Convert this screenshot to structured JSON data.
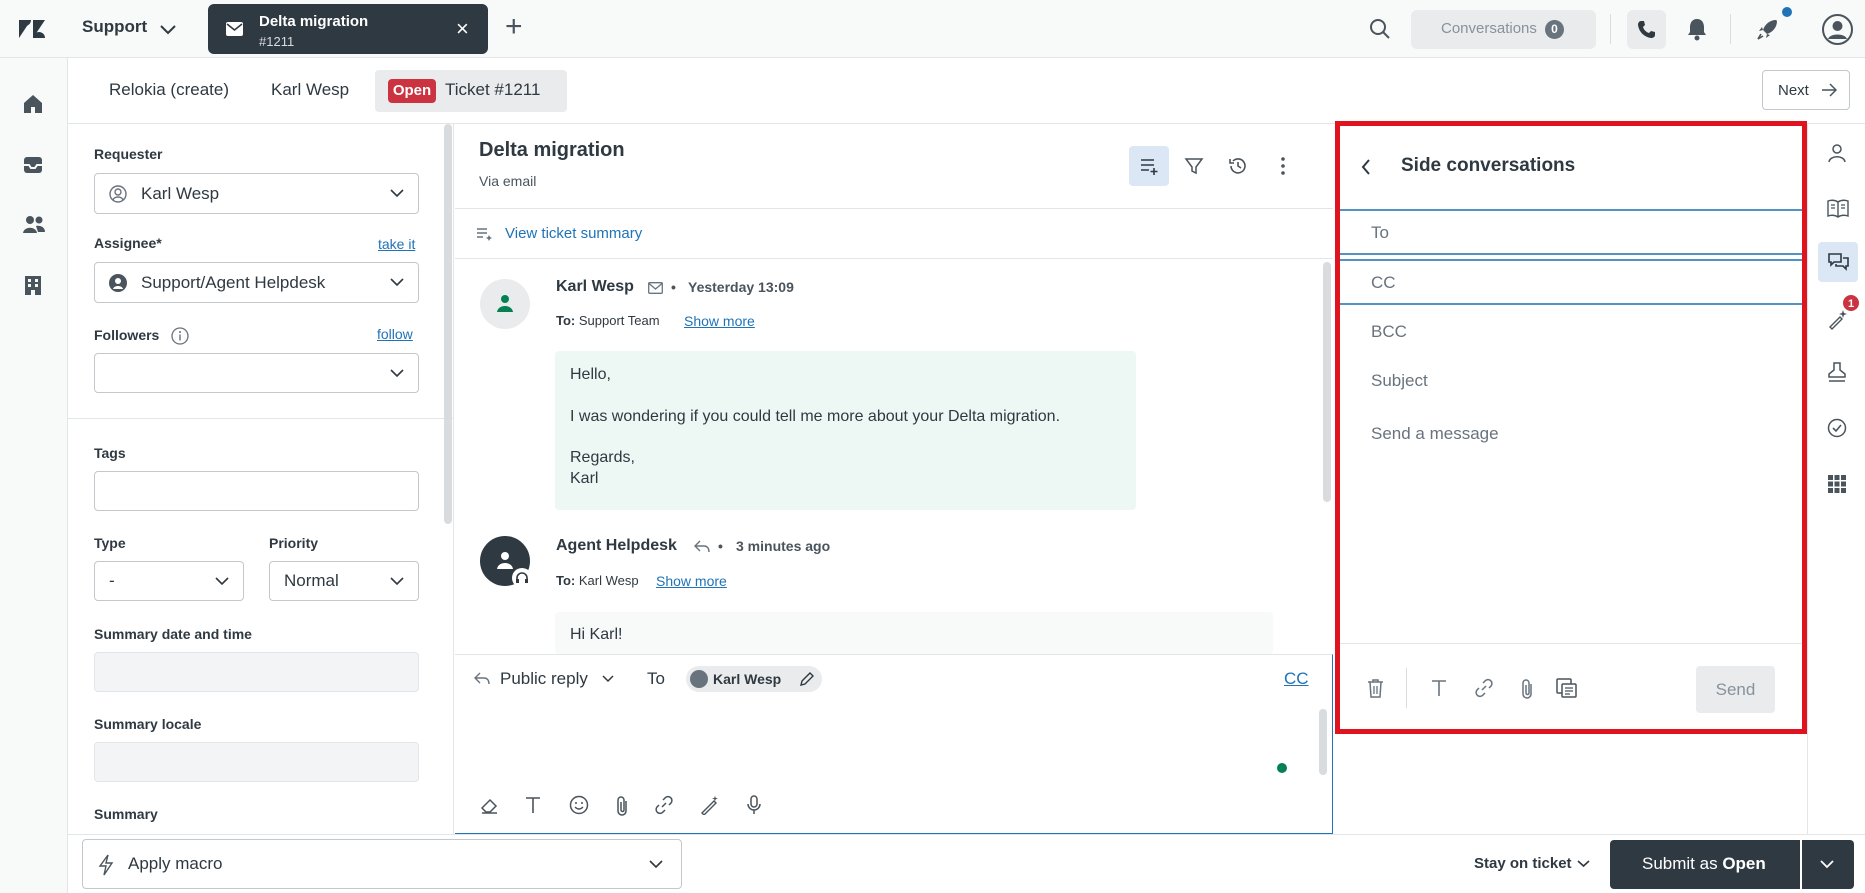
{
  "topbar": {
    "product": "Support",
    "active_tab": {
      "title": "Delta migration",
      "subtitle": "#1211",
      "icon": "mail-icon"
    },
    "conversations_label": "Conversations",
    "conversations_count": "0",
    "icons": [
      "search-icon",
      "phone-icon",
      "bell-icon",
      "rocket-icon",
      "user-avatar-icon"
    ]
  },
  "leftnav": {
    "icons": [
      "home-icon",
      "inbox-icon",
      "users-icon",
      "building-icon"
    ]
  },
  "breadcrumbs": {
    "items": [
      "Relokia (create)",
      "Karl Wesp"
    ],
    "status": "Open",
    "ticket": "Ticket #1211",
    "next_label": "Next"
  },
  "properties": {
    "requester_label": "Requester",
    "requester_value": "Karl Wesp",
    "assignee_label": "Assignee*",
    "take_it": "take it",
    "assignee_value": "Support/Agent Helpdesk",
    "followers_label": "Followers",
    "follow": "follow",
    "tags_label": "Tags",
    "type_label": "Type",
    "type_value": "-",
    "priority_label": "Priority",
    "priority_value": "Normal",
    "summary_dt_label": "Summary date and time",
    "summary_locale_label": "Summary locale",
    "summary_label": "Summary"
  },
  "conversation": {
    "title": "Delta migration",
    "via": "Via email",
    "summary_link": "View ticket summary",
    "messages": [
      {
        "author": "Karl Wesp",
        "time": "Yesterday 13:09",
        "to_label": "To:",
        "to": "Support Team",
        "show_more": "Show more",
        "lines": [
          "Hello,",
          "I was wondering if you could tell me more about your Delta migration.",
          "Regards,",
          "Karl"
        ]
      },
      {
        "author": "Agent Helpdesk",
        "time": "3 minutes ago",
        "to_label": "To:",
        "to": "Karl Wesp",
        "show_more": "Show more",
        "lines": [
          "Hi Karl!"
        ]
      }
    ]
  },
  "composer": {
    "reply_type": "Public reply",
    "to_label": "To",
    "recipient": "Karl Wesp",
    "cc": "CC"
  },
  "side_conversations": {
    "title": "Side conversations",
    "to": "To",
    "cc": "CC",
    "bcc": "BCC",
    "subject": "Subject",
    "message_placeholder": "Send a message",
    "send": "Send"
  },
  "rail": {
    "badge": "1"
  },
  "bottom": {
    "macro": "Apply macro",
    "stay": "Stay on ticket",
    "submit_prefix": "Submit as",
    "submit_status": "Open"
  },
  "colors": {
    "accent": "#1f73b7",
    "dark": "#2f3941",
    "open_badge": "#cc3340",
    "highlight_frame": "#e0141e",
    "bubble_customer": "#edf8f4"
  }
}
